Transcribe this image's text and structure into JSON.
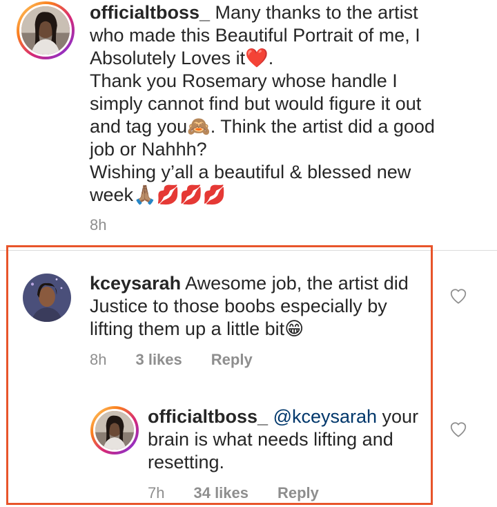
{
  "caption": {
    "username": "officialtboss_",
    "text": " Many thanks to the artist\nwho made this Beautiful Portrait of me, I\nAbsolutely Loves it❤️.\nThank you Rosemary whose handle I\nsimply cannot find but would figure it out\nand tag you🙈. Think the artist did a good\njob or Nahhh?\nWishing y’all a beautiful & blessed new\nweek🙏🏽💋💋💋",
    "time": "8h"
  },
  "comment": {
    "username": "kceysarah",
    "text": " Awesome job, the artist did\nJustice to those boobs especially by\nlifting them up a little bit😁",
    "time": "8h",
    "likes": "3 likes",
    "reply_label": "Reply"
  },
  "reply": {
    "username": "officialtboss_",
    "mention": "@kceysarah",
    "text": " your\nbrain is what needs lifting and\nresetting.",
    "time": "7h",
    "likes": "34 likes",
    "reply_label": "Reply"
  },
  "icons": {
    "like": "heart-outline-icon"
  },
  "colors": {
    "highlight_border": "#e8542a",
    "mention": "#00376b",
    "meta_text": "#8e8e8e"
  }
}
